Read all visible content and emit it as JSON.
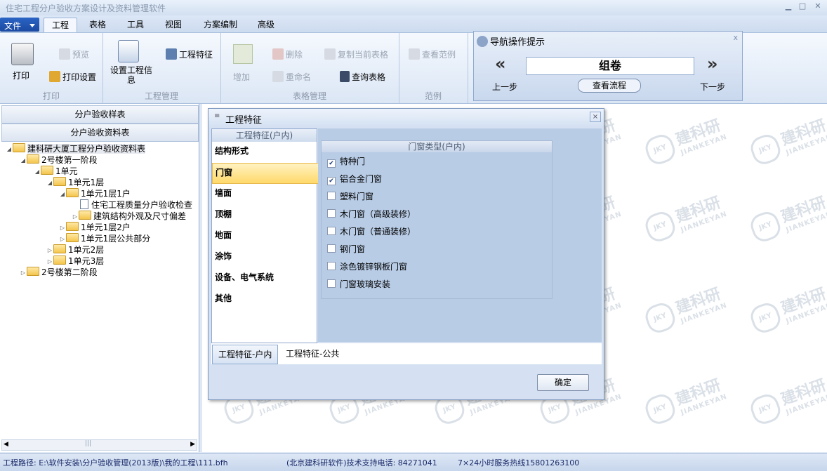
{
  "app": {
    "title": "住宅工程分户验收方案设计及资料管理软件"
  },
  "menu": {
    "file": "文件",
    "tabs": [
      "工程",
      "表格",
      "工具",
      "视图",
      "方案编制",
      "高级"
    ]
  },
  "ribbon": {
    "groups": {
      "print": {
        "label": "打印",
        "print": "打印",
        "preview": "预览",
        "print_setup": "打印设置"
      },
      "project": {
        "label": "工程管理",
        "set_info": "设置工程信息",
        "features": "工程特征"
      },
      "tables": {
        "label": "表格管理",
        "add": "增加",
        "delete": "删除",
        "rename": "重命名",
        "copy": "复制当前表格",
        "query": "查询表格"
      },
      "sample": {
        "label": "范例",
        "view_sample": "查看范例"
      }
    }
  },
  "nav_hint": {
    "title": "导航操作提示",
    "current": "组卷",
    "prev": "上一步",
    "next": "下一步",
    "view_flow": "查看流程",
    "prev_arrow": "«",
    "next_arrow": "»",
    "close": "x"
  },
  "left_panel": {
    "btn1": "分户验收样表",
    "btn2": "分户验收资料表",
    "tree": [
      {
        "label": "建科研大厦工程分户验收资料表",
        "type": "folder",
        "expander": "◢"
      },
      {
        "label": "2号楼第一阶段",
        "type": "folder",
        "expander": "◢"
      },
      {
        "label": "1单元",
        "type": "folder",
        "expander": "◢"
      },
      {
        "label": "1单元1层",
        "type": "folder",
        "expander": "◢"
      },
      {
        "label": "1单元1层1户",
        "type": "folder",
        "expander": "◢"
      },
      {
        "label": "住宅工程质量分户验收检查",
        "type": "doc",
        "expander": ""
      },
      {
        "label": "建筑结构外观及尺寸偏差",
        "type": "folder",
        "expander": "▷"
      },
      {
        "label": "1单元1层2户",
        "type": "folder",
        "expander": "▷"
      },
      {
        "label": "1单元1层公共部分",
        "type": "folder",
        "expander": "▷"
      },
      {
        "label": "1单元2层",
        "type": "folder",
        "expander": "▷"
      },
      {
        "label": "1单元3层",
        "type": "folder",
        "expander": "▷"
      },
      {
        "label": "2号楼第二阶段",
        "type": "folder",
        "expander": "▷"
      }
    ],
    "scroll_thumb": "|||"
  },
  "watermark": {
    "cn": "建科研",
    "en": "JIANKEYAN",
    "badge": "JKY"
  },
  "dialog": {
    "title": "工程特征",
    "list_header": "工程特征(户内)",
    "categories": [
      "结构形式",
      "门窗",
      "墙面",
      "顶棚",
      "地面",
      "涂饰",
      "设备、电气系统",
      "其他"
    ],
    "selected_category": "门窗",
    "group_header": "门窗类型(户内)",
    "options": [
      {
        "label": "特种门",
        "checked": true
      },
      {
        "label": "铝合金门窗",
        "checked": true
      },
      {
        "label": "塑料门窗",
        "checked": false
      },
      {
        "label": "木门窗（高级装修）",
        "checked": false
      },
      {
        "label": "木门窗（普通装修）",
        "checked": false
      },
      {
        "label": "钢门窗",
        "checked": false
      },
      {
        "label": "涂色镀锌钢板门窗",
        "checked": false
      },
      {
        "label": "门窗玻璃安装",
        "checked": false
      }
    ],
    "tabs": [
      "工程特征-户内",
      "工程特征-公共"
    ],
    "ok": "确定",
    "close": "×"
  },
  "status": {
    "path": "工程路径: E:\\软件安装\\分户验收管理(2013版)\\我的工程\\111.bfh",
    "support": "(北京建科研软件)技术支持电话: 84271041",
    "hotline": "7×24小时服务热线15801263100"
  }
}
